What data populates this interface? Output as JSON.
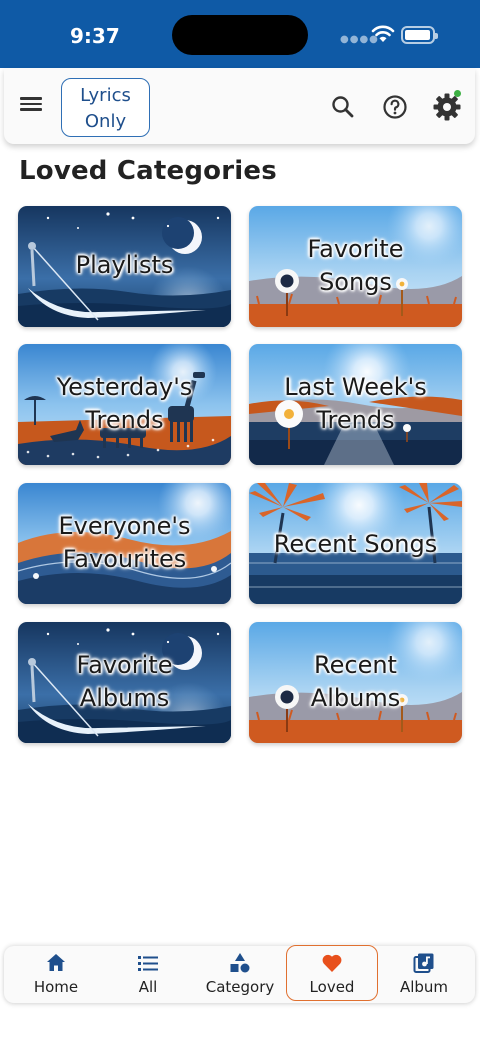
{
  "status_bar": {
    "time": "9:37"
  },
  "toolbar": {
    "menu_icon": "hamburger-menu-icon",
    "lyrics_only": {
      "line1": "Lyrics",
      "line2": "Only"
    },
    "search_icon": "search-icon",
    "help_icon": "help-circle-icon",
    "settings_icon": "gear-icon"
  },
  "page": {
    "title": "Loved Categories"
  },
  "categories": [
    {
      "line1": "Playlists",
      "line2": "",
      "scene": "night-boat"
    },
    {
      "line1": "Favorite",
      "line2": "Songs",
      "scene": "daisy-field"
    },
    {
      "line1": "Yesterday's",
      "line2": "Trends",
      "scene": "savanna-giraffe"
    },
    {
      "line1": "Last Week's",
      "line2": "Trends",
      "scene": "river-sunset"
    },
    {
      "line1": "Everyone's",
      "line2": "Favourites",
      "scene": "waves"
    },
    {
      "line1": "Recent Songs",
      "line2": "",
      "scene": "palm-beach"
    },
    {
      "line1": "Favorite",
      "line2": "Albums",
      "scene": "night-boat"
    },
    {
      "line1": "Recent",
      "line2": "Albums",
      "scene": "daisy-field"
    }
  ],
  "bottom_nav": {
    "items": [
      {
        "label": "Home",
        "icon": "home-icon"
      },
      {
        "label": "All",
        "icon": "list-icon"
      },
      {
        "label": "Category",
        "icon": "shapes-icon"
      },
      {
        "label": "Loved",
        "icon": "heart-icon"
      },
      {
        "label": "Album",
        "icon": "album-icon"
      }
    ],
    "active": "Loved",
    "active_color": "#e07030"
  },
  "colors": {
    "status_bar": "#0f5aa6",
    "accent_blue": "#2f6fb5",
    "heart": "#e8501c"
  }
}
